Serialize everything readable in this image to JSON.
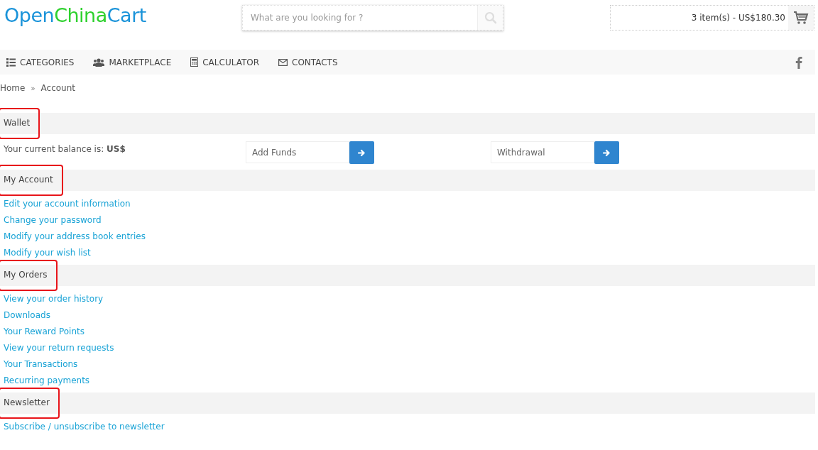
{
  "logo": [
    {
      "text": "Open",
      "color": "#1a93d9"
    },
    {
      "text": "China",
      "color": "#2ed12e"
    },
    {
      "text": "Cart",
      "color": "#1a93d9"
    }
  ],
  "search": {
    "placeholder": "What are you looking for ?"
  },
  "cart": {
    "summary": "3 item(s) - US$180.30"
  },
  "nav": [
    {
      "label": "CATEGORIES"
    },
    {
      "label": "MARKETPLACE"
    },
    {
      "label": "CALCULATOR"
    },
    {
      "label": "CONTACTS"
    }
  ],
  "breadcrumb": {
    "items": [
      "Home",
      "Account"
    ],
    "separator": "»"
  },
  "sections": [
    {
      "title": "Wallet",
      "highlighted": true,
      "kind": "wallet",
      "balance": "Your current balance is: **US$**",
      "fields": [
        {
          "placeholder": "Add Funds"
        },
        {
          "placeholder": "Withdrawal"
        }
      ]
    },
    {
      "title": "My Account",
      "highlighted": true,
      "kind": "links",
      "links": [
        "Edit your account information",
        "Change your password",
        "Modify your address book entries",
        "Modify your wish list"
      ]
    },
    {
      "title": "My Orders",
      "highlighted": true,
      "kind": "links",
      "links": [
        "View your order history",
        "Downloads",
        "Your Reward Points",
        "View your return requests",
        "Your Transactions",
        "Recurring payments"
      ]
    },
    {
      "title": "Newsletter",
      "highlighted": true,
      "kind": "links",
      "links": [
        "Subscribe / unsubscribe to newsletter"
      ]
    }
  ]
}
